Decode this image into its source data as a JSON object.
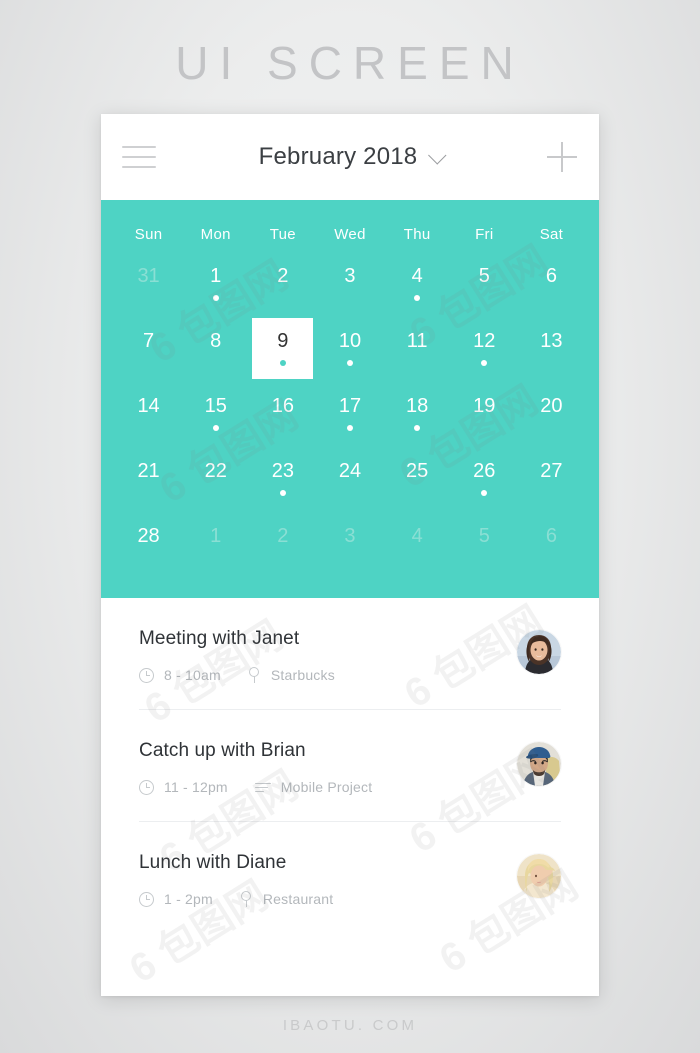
{
  "page": {
    "title": "UI SCREEN",
    "footer": "IBAOTU. COM"
  },
  "colors": {
    "accent": "#4ed3c4",
    "accent_muted": "#8adfd4",
    "text_dark": "#2f3337",
    "text_muted": "#b3b7bb",
    "card_bg": "#ffffff",
    "page_bg": "#ececed"
  },
  "topbar": {
    "menu_icon": "hamburger-menu-icon",
    "month_label": "February 2018",
    "chevron_icon": "chevron-down-icon",
    "add_icon": "plus-icon"
  },
  "calendar": {
    "day_names": [
      "Sun",
      "Mon",
      "Tue",
      "Wed",
      "Thu",
      "Fri",
      "Sat"
    ],
    "selected_day": 9,
    "weeks": [
      [
        {
          "num": "31",
          "muted": true,
          "dot": false
        },
        {
          "num": "1",
          "muted": false,
          "dot": true
        },
        {
          "num": "2",
          "muted": false,
          "dot": false
        },
        {
          "num": "3",
          "muted": false,
          "dot": false
        },
        {
          "num": "4",
          "muted": false,
          "dot": true
        },
        {
          "num": "5",
          "muted": false,
          "dot": false
        },
        {
          "num": "6",
          "muted": false,
          "dot": false
        }
      ],
      [
        {
          "num": "7",
          "muted": false,
          "dot": false
        },
        {
          "num": "8",
          "muted": false,
          "dot": false
        },
        {
          "num": "9",
          "muted": false,
          "dot": true,
          "selected": true
        },
        {
          "num": "10",
          "muted": false,
          "dot": true
        },
        {
          "num": "11",
          "muted": false,
          "dot": false
        },
        {
          "num": "12",
          "muted": false,
          "dot": true
        },
        {
          "num": "13",
          "muted": false,
          "dot": false
        }
      ],
      [
        {
          "num": "14",
          "muted": false,
          "dot": false
        },
        {
          "num": "15",
          "muted": false,
          "dot": true
        },
        {
          "num": "16",
          "muted": false,
          "dot": false
        },
        {
          "num": "17",
          "muted": false,
          "dot": true
        },
        {
          "num": "18",
          "muted": false,
          "dot": true
        },
        {
          "num": "19",
          "muted": false,
          "dot": false
        },
        {
          "num": "20",
          "muted": false,
          "dot": false
        }
      ],
      [
        {
          "num": "21",
          "muted": false,
          "dot": false
        },
        {
          "num": "22",
          "muted": false,
          "dot": false
        },
        {
          "num": "23",
          "muted": false,
          "dot": true
        },
        {
          "num": "24",
          "muted": false,
          "dot": false
        },
        {
          "num": "25",
          "muted": false,
          "dot": false
        },
        {
          "num": "26",
          "muted": false,
          "dot": true
        },
        {
          "num": "27",
          "muted": false,
          "dot": false
        }
      ],
      [
        {
          "num": "28",
          "muted": false,
          "dot": false
        },
        {
          "num": "1",
          "muted": true,
          "dot": false
        },
        {
          "num": "2",
          "muted": true,
          "dot": false
        },
        {
          "num": "3",
          "muted": true,
          "dot": false
        },
        {
          "num": "4",
          "muted": true,
          "dot": false
        },
        {
          "num": "5",
          "muted": true,
          "dot": false
        },
        {
          "num": "6",
          "muted": true,
          "dot": false
        }
      ]
    ]
  },
  "events": [
    {
      "title": "Meeting with Janet",
      "time": "8 - 10am",
      "time_icon": "clock-icon",
      "detail": "Starbucks",
      "detail_icon": "location-pin-icon",
      "avatar": "avatar-janet"
    },
    {
      "title": "Catch up with Brian",
      "time": "11 - 12pm",
      "time_icon": "clock-icon",
      "detail": "Mobile Project",
      "detail_icon": "list-lines-icon",
      "avatar": "avatar-brian"
    },
    {
      "title": "Lunch with Diane",
      "time": "1 - 2pm",
      "time_icon": "clock-icon",
      "detail": "Restaurant",
      "detail_icon": "location-pin-icon",
      "avatar": "avatar-diane"
    }
  ],
  "watermarks": [
    "6 包图网",
    "6 包图网",
    "6 包图网",
    "6 包图网",
    "6 包图网",
    "6 包图网"
  ]
}
